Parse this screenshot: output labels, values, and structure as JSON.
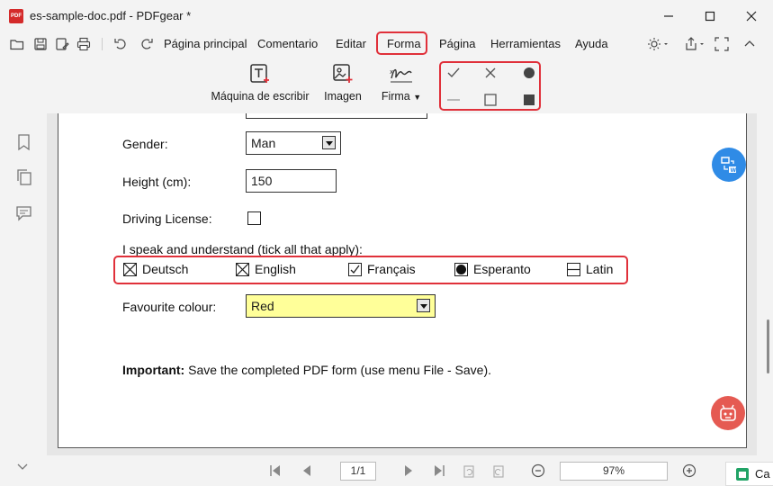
{
  "window": {
    "title": "es-sample-doc.pdf - PDFgear *",
    "logo_text": "PDF",
    "controls": [
      "minimize-icon",
      "maximize-icon",
      "close-icon"
    ]
  },
  "quick_access": [
    "open-folder-icon",
    "save-icon",
    "save-as-icon",
    "print-icon",
    "undo-icon",
    "redo-icon"
  ],
  "menu": {
    "items": [
      "Página principal",
      "Comentario",
      "Editar",
      "Forma",
      "Página",
      "Herramientas",
      "Ayuda"
    ],
    "active": "Forma"
  },
  "ribbon": {
    "tools": [
      {
        "label": "Máquina de escribir",
        "icon": "typewriter-icon"
      },
      {
        "label": "Imagen",
        "icon": "image-icon"
      },
      {
        "label": "Firma",
        "icon": "signature-icon"
      }
    ],
    "shapes": [
      "checkmark-icon",
      "cross-icon",
      "filled-circle-icon",
      "line-icon",
      "empty-square-icon",
      "filled-square-icon"
    ]
  },
  "form": {
    "gender_label": "Gender:",
    "gender_value": "Man",
    "height_label": "Height (cm):",
    "height_value": "150",
    "license_label": "Driving License:",
    "speak_label": "I speak and understand (tick all that apply):",
    "languages": [
      {
        "name": "Deutsch",
        "state": "crossed"
      },
      {
        "name": "English",
        "state": "crossed"
      },
      {
        "name": "Français",
        "state": "checked"
      },
      {
        "name": "Esperanto",
        "state": "filled-circle"
      },
      {
        "name": "Latin",
        "state": "line"
      }
    ],
    "colour_label": "Favourite colour:",
    "colour_value": "Red",
    "important_bold": "Important:",
    "important_text": " Save the completed PDF form (use menu File - Save)."
  },
  "nav": {
    "page": "1/1",
    "zoom": "97%"
  },
  "taskbar": {
    "label": "Ca"
  },
  "colors": {
    "highlight": "#e0303a",
    "field_yellow": "#ffff99",
    "convert_fab": "#2f8be6",
    "assistant_fab": "#e55a52"
  }
}
